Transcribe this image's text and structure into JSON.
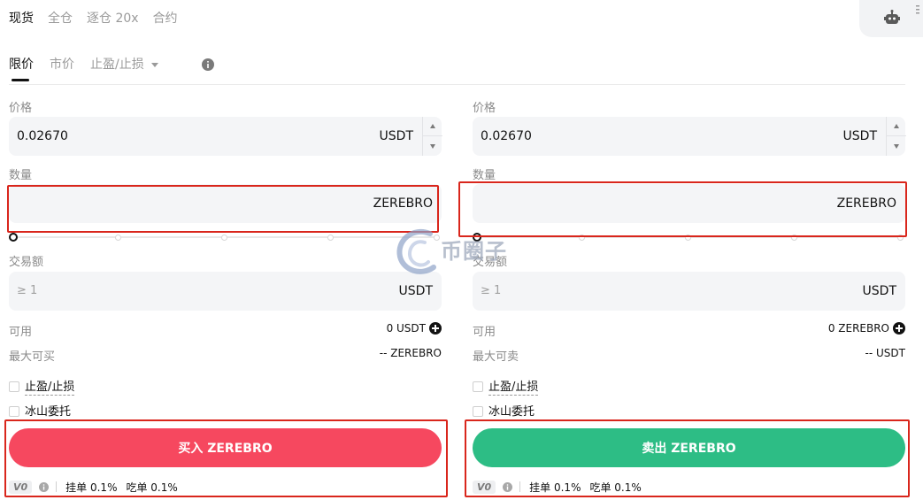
{
  "top_tabs": [
    "现货",
    "全仓",
    "逐仓 20x",
    "合约"
  ],
  "order_tabs": {
    "limit": "限价",
    "market": "市价",
    "tpsl": "止盈/止损"
  },
  "buy": {
    "price_label": "价格",
    "price_value": "0.02670",
    "price_unit": "USDT",
    "qty_label": "数量",
    "qty_unit": "ZEREBRO",
    "amount_label": "交易额",
    "amount_placeholder": "≥ 1",
    "amount_unit": "USDT",
    "avail_label": "可用",
    "avail_value": "0 USDT",
    "max_label": "最大可买",
    "max_value": "-- ZEREBRO",
    "tpsl_label": "止盈/止损",
    "iceberg_label": "冰山委托",
    "button_label": "买入 ZEREBRO",
    "vip": "V0",
    "maker": "挂单 0.1%",
    "taker": "吃单 0.1%"
  },
  "sell": {
    "price_label": "价格",
    "price_value": "0.02670",
    "price_unit": "USDT",
    "qty_label": "数量",
    "qty_unit": "ZEREBRO",
    "amount_label": "交易额",
    "amount_placeholder": "≥ 1",
    "amount_unit": "USDT",
    "avail_label": "可用",
    "avail_value": "0 ZEREBRO",
    "max_label": "最大可卖",
    "max_value": "-- USDT",
    "tpsl_label": "止盈/止损",
    "iceberg_label": "冰山委托",
    "button_label": "卖出 ZEREBRO",
    "vip": "V0",
    "maker": "挂单 0.1%",
    "taker": "吃单 0.1%"
  },
  "watermark": "币圈子",
  "colors": {
    "buy": "#f6485f",
    "sell": "#2dbd85",
    "highlight": "#d9261c"
  }
}
